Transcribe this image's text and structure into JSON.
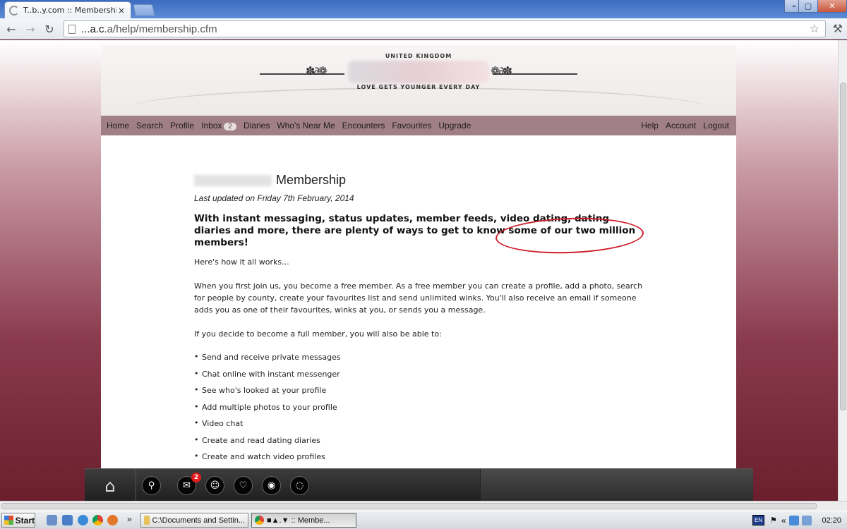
{
  "browser": {
    "tab_title": "T..b..y.com :: Membership",
    "tab_close": "×",
    "url_prefix": " ",
    "url_host": "...a.c",
    "url_path": ".a/help/membership.cfm",
    "back": "←",
    "forward": "→",
    "reload": "↻",
    "star": "☆",
    "wrench": "⚒",
    "win_minimize": "–",
    "win_maximize": "▢",
    "win_close": "✕"
  },
  "banner": {
    "country": "UNITED KINGDOM",
    "tagline": "LOVE GETS YOUNGER EVERY DAY",
    "swirl_left": "✽∂❁⁠",
    "swirl_right": "⁠❁∂✽"
  },
  "nav": {
    "left": [
      {
        "label": "Home"
      },
      {
        "label": "Search"
      },
      {
        "label": "Profile"
      },
      {
        "label": "Inbox"
      },
      {
        "label": "Diaries"
      },
      {
        "label": "Who's Near Me"
      },
      {
        "label": "Encounters"
      },
      {
        "label": "Favourites"
      },
      {
        "label": "Upgrade"
      }
    ],
    "inbox_count": "2",
    "right": [
      {
        "label": "Help"
      },
      {
        "label": "Account"
      },
      {
        "label": "Logout"
      }
    ]
  },
  "content": {
    "title": "Membership",
    "updated": "Last updated on Friday 7th February, 2014",
    "lead": "With instant messaging, status updates, member feeds, video dating, dating diaries and more, there are plenty of ways to get to know some of our two million members!",
    "intro": "Here's how it all works...",
    "free_member": "When you first join us, you become a free member. As a free member you can create a profile, add a photo, search for people by county, create your favourites list and send unlimited winks. You'll also receive an email if someone adds you as one of their favourites, winks at you, or sends you a message.",
    "full_member": "If you decide to become a full member, you will also be able to:",
    "features": [
      "Send and receive private messages",
      "Chat online with instant messenger",
      "See who's looked at your profile",
      "Add multiple photos to your profile",
      "Video chat",
      "Create and read dating diaries",
      "Create and watch video profiles"
    ]
  },
  "dock": {
    "home_icon": "⌂",
    "search_icon": "⚲",
    "inbox_icon": "✉",
    "inbox_badge": "2",
    "winks_icon": "☺",
    "favourites_icon": "♡",
    "viewed_icon": "◉",
    "chat_icon": "◌"
  },
  "taskbar": {
    "start": "Start",
    "chevron": "»",
    "task_explorer": "C:\\Documents and Settin...",
    "task_chrome": "■▲.▼ :: Membe...",
    "lang": "EN",
    "tray_chevron": "«",
    "clock": "02:20"
  },
  "colors": {
    "nav_bg": "#a17f86",
    "annotation_circle": "#cc1f2a",
    "page_bg_dark": "#6b1f2c"
  }
}
